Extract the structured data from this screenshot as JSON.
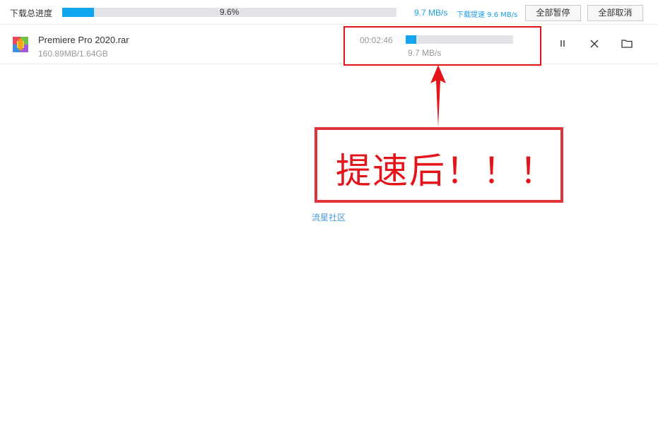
{
  "header": {
    "total_label": "下载总进度",
    "total_progress": 9.6,
    "total_progress_text": "9.6%",
    "total_speed": "9.7 MB/s",
    "boost_speed": "下载提速 9.6 MB/s",
    "pause_all_label": "全部暂停",
    "cancel_all_label": "全部取消"
  },
  "task": {
    "icon": "winrar-archive-icon",
    "file_name": "Premiere Pro 2020.rar",
    "size_text": "160.89MB/1.64GB",
    "remaining_time": "00:02:46",
    "progress": 9.6,
    "speed": "9.7 MB/s",
    "actions": {
      "pause_icon": "pause-icon",
      "close_icon": "close-icon",
      "folder_icon": "folder-icon"
    }
  },
  "annotation": {
    "note": "提速后！！！",
    "color": "#e3151a"
  },
  "watermark": "流星社区",
  "colors": {
    "accent": "#11a6ee",
    "track": "#e3e4e8",
    "link": "#1b9fe6"
  }
}
